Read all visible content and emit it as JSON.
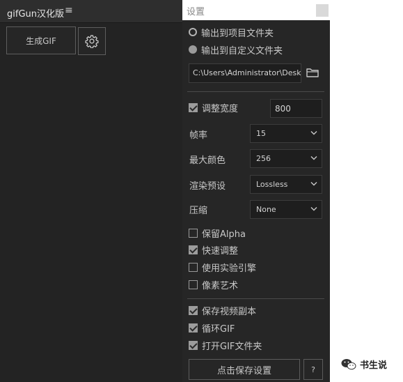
{
  "panel": {
    "title": "gifGun汉化版",
    "menu_icon": "hamburger-icon",
    "generate_label": "生成GIF",
    "gear_icon": "gear-icon"
  },
  "dialog": {
    "title": "设置",
    "output": {
      "option_project": "输出到项目文件夹",
      "option_custom": "输出到自定义文件夹",
      "selected": "project",
      "path_value": "C:\\Users\\Administrator\\Deskto",
      "folder_icon": "folder-icon"
    },
    "resize": {
      "label": "调整宽度",
      "checked": true,
      "width_value": "800"
    },
    "fps": {
      "label": "帧率",
      "value": "15"
    },
    "max_colors": {
      "label": "最大颜色",
      "value": "256"
    },
    "render_preset": {
      "label": "渲染预设",
      "value": "Lossless"
    },
    "compression": {
      "label": "压缩",
      "value": "None"
    },
    "options": [
      {
        "label": "保留Alpha",
        "checked": false
      },
      {
        "label": "快速调整",
        "checked": true
      },
      {
        "label": "使用实验引擎",
        "checked": false
      },
      {
        "label": "像素艺术",
        "checked": false
      }
    ],
    "extra_options": [
      {
        "label": "保存视频副本",
        "checked": true
      },
      {
        "label": "循环GIF",
        "checked": true
      },
      {
        "label": "打开GIF文件夹",
        "checked": true
      }
    ],
    "save_label": "点击保存设置",
    "help_label": "?"
  },
  "watermark": {
    "text": "书生说",
    "icon": "wechat-icon"
  },
  "colors": {
    "panel_bg": "#232323",
    "dialog_bg": "#262626",
    "input_bg": "#1e1e1e",
    "text": "#c8c8c8"
  }
}
